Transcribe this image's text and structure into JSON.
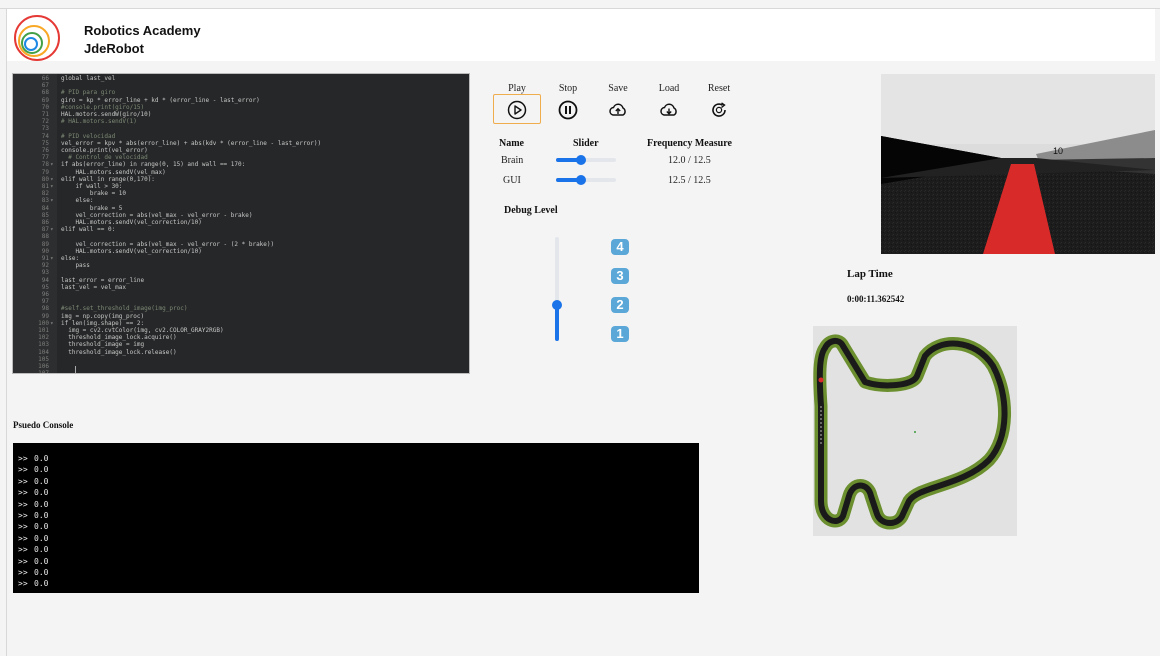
{
  "header": {
    "app_name": "Robotics Academy",
    "org_name": "JdeRobot"
  },
  "editor": {
    "lines": [
      {
        "n": "66",
        "f": "",
        "t": "global last_vel"
      },
      {
        "n": "67",
        "f": "",
        "t": ""
      },
      {
        "n": "68",
        "f": "",
        "t": "# PID para giro"
      },
      {
        "n": "69",
        "f": "",
        "t": "giro = kp * error_line + kd * (error_line - last_error)"
      },
      {
        "n": "70",
        "f": "",
        "t": "#console.print(giro/15)"
      },
      {
        "n": "71",
        "f": "",
        "t": "HAL.motors.sendW(giro/10)"
      },
      {
        "n": "72",
        "f": "",
        "t": "# HAL.motors.sendV(1)"
      },
      {
        "n": "73",
        "f": "",
        "t": ""
      },
      {
        "n": "74",
        "f": "",
        "t": "# PID velocidad"
      },
      {
        "n": "75",
        "f": "",
        "t": "vel_error = kpv * abs(error_line) + abs(kdv * (error_line - last_error))"
      },
      {
        "n": "76",
        "f": "",
        "t": "console.print(vel_error)"
      },
      {
        "n": "77",
        "f": "",
        "t": "  # Control de velocidad"
      },
      {
        "n": "78",
        "f": "▾",
        "t": "if abs(error_line) in range(0, 15) and wall == 170:"
      },
      {
        "n": "79",
        "f": "",
        "t": "    HAL.motors.sendV(vel_max)"
      },
      {
        "n": "80",
        "f": "▾",
        "t": "elif wall in range(0,170):"
      },
      {
        "n": "81",
        "f": "▾",
        "t": "    if wall > 30:"
      },
      {
        "n": "82",
        "f": "",
        "t": "        brake = 10"
      },
      {
        "n": "83",
        "f": "▾",
        "t": "    else:"
      },
      {
        "n": "84",
        "f": "",
        "t": "        brake = 5"
      },
      {
        "n": "85",
        "f": "",
        "t": "    vel_correction = abs(vel_max - vel_error - brake)"
      },
      {
        "n": "86",
        "f": "",
        "t": "    HAL.motors.sendV(vel_correction/10)"
      },
      {
        "n": "87",
        "f": "▾",
        "t": "elif wall == 0:"
      },
      {
        "n": "88",
        "f": "",
        "t": ""
      },
      {
        "n": "89",
        "f": "",
        "t": "    vel_correction = abs(vel_max - vel_error - (2 * brake))"
      },
      {
        "n": "90",
        "f": "",
        "t": "    HAL.motors.sendV(vel_correction/10)"
      },
      {
        "n": "91",
        "f": "▾",
        "t": "else:"
      },
      {
        "n": "92",
        "f": "",
        "t": "    pass"
      },
      {
        "n": "93",
        "f": "",
        "t": ""
      },
      {
        "n": "94",
        "f": "",
        "t": "last_error = error_line"
      },
      {
        "n": "95",
        "f": "",
        "t": "last_vel = vel_max"
      },
      {
        "n": "96",
        "f": "",
        "t": ""
      },
      {
        "n": "97",
        "f": "",
        "t": ""
      },
      {
        "n": "98",
        "f": "",
        "t": "#self.set_threshold_image(img_proc)"
      },
      {
        "n": "99",
        "f": "",
        "t": "img = np.copy(img_proc)"
      },
      {
        "n": "100",
        "f": "▾",
        "t": "if len(img.shape) == 2:"
      },
      {
        "n": "101",
        "f": "",
        "t": "  img = cv2.cvtColor(img, cv2.COLOR_GRAY2RGB)"
      },
      {
        "n": "102",
        "f": "",
        "t": "  threshold_image_lock.acquire()"
      },
      {
        "n": "103",
        "f": "",
        "t": "  threshold_image = img"
      },
      {
        "n": "104",
        "f": "",
        "t": "  threshold_image_lock.release()"
      },
      {
        "n": "105",
        "f": "",
        "t": ""
      },
      {
        "n": "106",
        "f": "",
        "t": ""
      },
      {
        "n": "107",
        "f": "",
        "t": ""
      }
    ]
  },
  "controls": {
    "play": "Play",
    "stop": "Stop",
    "save": "Save",
    "load": "Load",
    "reset": "Reset"
  },
  "freq_table": {
    "col_name": "Name",
    "col_slider": "Slider",
    "col_freq": "Frequency Measure",
    "rows": [
      {
        "name": "Brain",
        "slider_value": 0.42,
        "freq": "12.0 / 12.5"
      },
      {
        "name": "GUI",
        "slider_value": 0.42,
        "freq": "12.5 / 12.5"
      }
    ]
  },
  "debug": {
    "title": "Debug Level",
    "level": 2,
    "levels": [
      "4",
      "3",
      "2",
      "1"
    ]
  },
  "camera": {
    "overlay_text": "10"
  },
  "lap": {
    "title": "Lap Time",
    "value": "0:00:11.362542"
  },
  "console": {
    "title": "Psuedo Console",
    "prompt": ">>",
    "lines": [
      "0.0",
      "0.0",
      "0.0",
      "0.0",
      "0.0",
      "0.0",
      "0.0",
      "0.0",
      "0.0",
      "0.0",
      "0.0",
      "0.0"
    ]
  },
  "colors": {
    "accent": "#1a73e8",
    "play_border": "#f0ad4e",
    "debug_badge": "#5aa7d8",
    "track_green": "#6b8f2e",
    "road_line": "#d92a2a"
  }
}
